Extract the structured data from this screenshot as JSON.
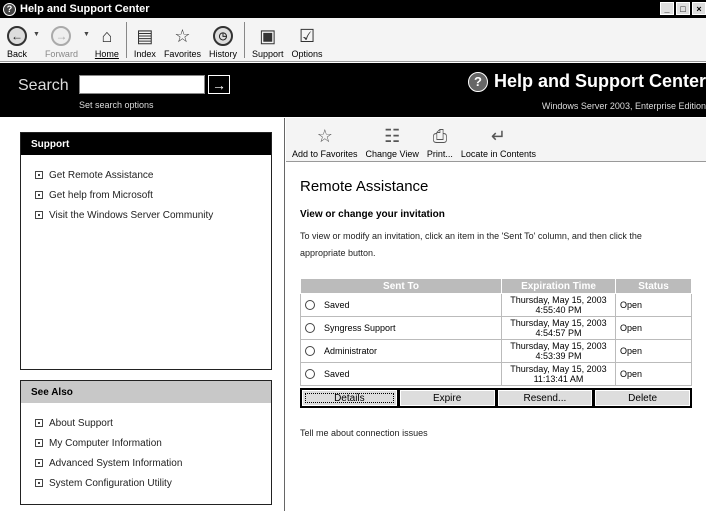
{
  "window": {
    "title": "Help and Support Center",
    "controls": [
      "_",
      "□",
      "×"
    ]
  },
  "toolbar": {
    "back": "Back",
    "forward": "Forward",
    "home": "Home",
    "index": "Index",
    "favorites": "Favorites",
    "history": "History",
    "support": "Support",
    "options": "Options"
  },
  "search": {
    "label": "Search",
    "value": "",
    "placeholder": "",
    "options_link": "Set search options",
    "go": "→"
  },
  "brand": {
    "title": "Help and Support Center",
    "edition": "Windows Server 2003, Enterprise Edition"
  },
  "support_box": {
    "heading": "Support",
    "items": [
      "Get Remote Assistance",
      "Get help from Microsoft",
      "Visit the Windows Server Community"
    ]
  },
  "see_also_box": {
    "heading": "See Also",
    "items": [
      "About Support",
      "My Computer Information",
      "Advanced System Information",
      "System Configuration Utility"
    ]
  },
  "content_toolbar": {
    "add_favorites": "Add to Favorites",
    "change_view": "Change View",
    "print": "Print...",
    "locate": "Locate in Contents"
  },
  "content": {
    "title": "Remote Assistance",
    "subtitle": "View or change your invitation",
    "instructions": "To view or modify an invitation, click an item in the 'Sent To' column, and then click the appropriate button.",
    "table": {
      "headers": [
        "Sent To",
        "Expiration Time",
        "Status"
      ],
      "rows": [
        {
          "sent_to": "Saved",
          "date": "Thursday, May 15, 2003",
          "time": "4:55:40 PM",
          "status": "Open"
        },
        {
          "sent_to": "Syngress Support",
          "date": "Thursday, May 15, 2003",
          "time": "4:54:57 PM",
          "status": "Open"
        },
        {
          "sent_to": "Administrator",
          "date": "Thursday, May 15, 2003",
          "time": "4:53:39 PM",
          "status": "Open"
        },
        {
          "sent_to": "Saved",
          "date": "Thursday, May 15, 2003",
          "time": "11:13:41 AM",
          "status": "Open"
        }
      ]
    },
    "buttons": {
      "details": "Details",
      "expire": "Expire",
      "resend": "Resend...",
      "delete": "Delete"
    },
    "connection_link": "Tell me about connection issues"
  }
}
